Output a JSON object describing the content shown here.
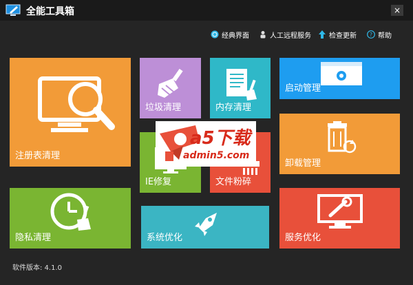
{
  "window": {
    "title": "全能工具箱",
    "close_glyph": "×"
  },
  "toolbar": [
    {
      "name": "classic-view",
      "label": "经典界面",
      "icon": "globe-icon"
    },
    {
      "name": "remote-service",
      "label": "人工远程服务",
      "icon": "person-icon"
    },
    {
      "name": "check-update",
      "label": "检查更新",
      "icon": "arrow-up-icon"
    },
    {
      "name": "help",
      "label": "帮助",
      "icon": "help-icon"
    }
  ],
  "tiles": {
    "registry": {
      "label": "注册表清理",
      "color": "#f29b38",
      "icon": "monitor-magnifier-icon"
    },
    "junk": {
      "label": "垃圾清理",
      "color": "#bd8fd7",
      "icon": "broom-icon"
    },
    "memory": {
      "label": "内存清理",
      "color": "#2fb8c8",
      "icon": "document-broom-icon"
    },
    "startup": {
      "label": "启动管理",
      "color": "#1e9df0",
      "icon": "window-gear-icon"
    },
    "ie": {
      "label": "IE修复",
      "color": "#7ab532",
      "icon": "monitor-icon"
    },
    "shred": {
      "label": "文件粉碎",
      "color": "#e8503a",
      "icon": "shredder-icon"
    },
    "uninstall": {
      "label": "卸载管理",
      "color": "#f29b38",
      "icon": "recycle-bin-icon"
    },
    "privacy": {
      "label": "隐私清理",
      "color": "#7ab532",
      "icon": "clock-broom-icon"
    },
    "optimize": {
      "label": "系统优化",
      "color": "#3bb5c3",
      "icon": "rocket-icon"
    },
    "service": {
      "label": "服务优化",
      "color": "#e8503a",
      "icon": "monitor-wrench-icon"
    }
  },
  "watermark": {
    "brand": "a5下载",
    "url": "admin5.com"
  },
  "footer": {
    "version": "软件版本: 4.1.0"
  }
}
